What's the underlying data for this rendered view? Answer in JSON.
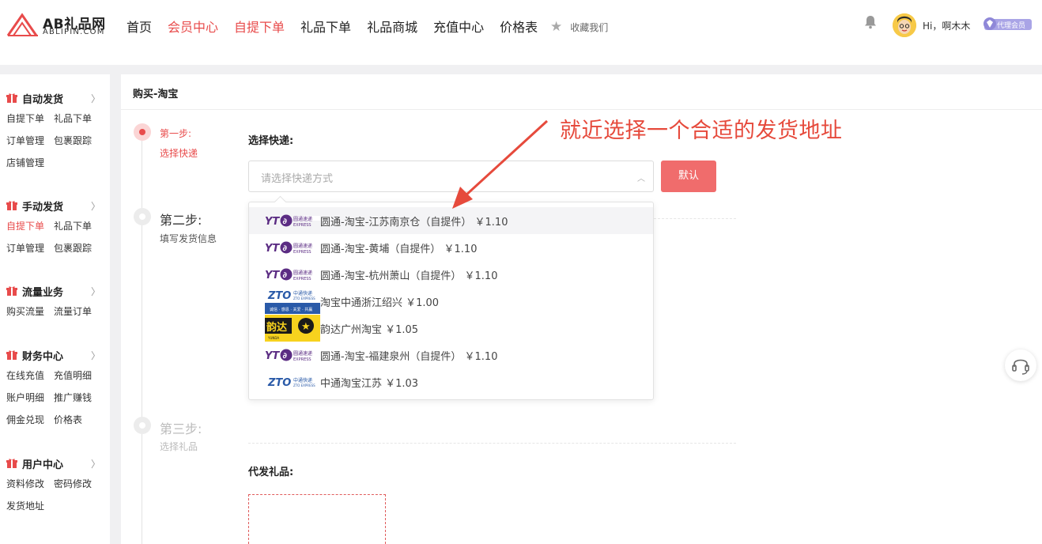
{
  "header": {
    "logo_main": "AB礼品网",
    "logo_sub": "ABLIPIN.COM",
    "nav": [
      "首页",
      "会员中心",
      "自提下单",
      "礼品下单",
      "礼品商城",
      "充值中心",
      "价格表"
    ],
    "favorite": "收藏我们",
    "greeting": "Hi，啊木木",
    "badge": "代理会员"
  },
  "sidebar": {
    "sections": [
      {
        "title": "自动发货",
        "links": [
          "自提下单",
          "礼品下单",
          "订单管理",
          "包裹跟踪",
          "店铺管理"
        ]
      },
      {
        "title": "手动发货",
        "links": [
          "自提下单",
          "礼品下单",
          "订单管理",
          "包裹跟踪"
        ]
      },
      {
        "title": "流量业务",
        "links": [
          "购买流量",
          "流量订单"
        ]
      },
      {
        "title": "财务中心",
        "links": [
          "在线充值",
          "充值明细",
          "账户明细",
          "推广赚钱",
          "佣金兑现",
          "价格表"
        ]
      },
      {
        "title": "用户中心",
        "links": [
          "资料修改",
          "密码修改",
          "发货地址"
        ]
      }
    ]
  },
  "main": {
    "title": "购买-淘宝",
    "steps": [
      {
        "num": "第一步:",
        "desc": "选择快递"
      },
      {
        "num": "第二步:",
        "desc": "填写发货信息"
      },
      {
        "num": "第三步:",
        "desc": "选择礼品"
      }
    ],
    "express_label": "选择快递:",
    "express_placeholder": "请选择快递方式",
    "default_button": "默认",
    "gift_label": "代发礼品:",
    "options": [
      {
        "carrier": "yto",
        "label": "圆通-淘宝-江苏南京仓（自提件） ￥1.10"
      },
      {
        "carrier": "yto",
        "label": "圆通-淘宝-黄埔（自提件） ￥1.10"
      },
      {
        "carrier": "yto",
        "label": "圆通-淘宝-杭州萧山（自提件） ￥1.10"
      },
      {
        "carrier": "zto",
        "label": "淘宝中通浙江绍兴 ￥1.00"
      },
      {
        "carrier": "yunda",
        "label": "韵达广州淘宝 ￥1.05"
      },
      {
        "carrier": "yto",
        "label": "圆通-淘宝-福建泉州（自提件） ￥1.10"
      },
      {
        "carrier": "zto",
        "label": "中通淘宝江苏 ￥1.03"
      }
    ]
  },
  "annotation": "就近选择一个合适的发货地址",
  "colors": {
    "accent": "#e84b4b",
    "button": "#f06c6c",
    "annotation": "#e64a3c"
  }
}
